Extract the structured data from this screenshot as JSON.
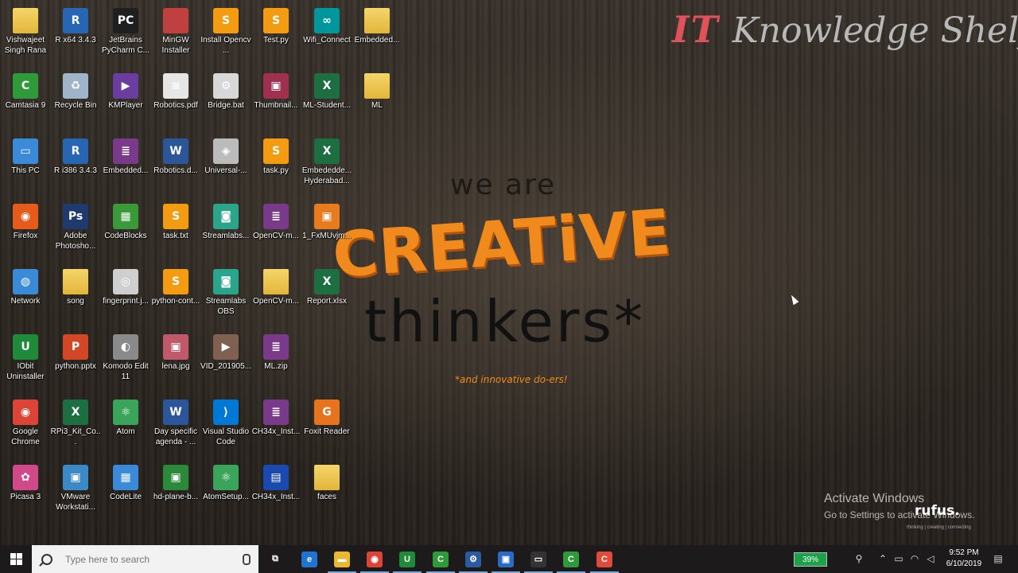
{
  "wallpaper": {
    "brand_it": "IT",
    "brand_name": "Knowledge Shelf",
    "we_are": "we are",
    "creative": "CREATiVE",
    "thinkers": "thinkers*",
    "tagline": "*and innovative do-ers!",
    "activate_title": "Activate Windows",
    "activate_sub": "Go to Settings to activate Windows.",
    "rufus": "rufus.",
    "rufus_sub": "thinking | creating | connecting"
  },
  "icons": [
    {
      "label": "Vishwajeet Singh Rana",
      "icon": "user-folder-icon",
      "color": "#e8c040",
      "glyph": ""
    },
    {
      "label": "R x64 3.4.3",
      "icon": "r-icon",
      "color": "#2766b3",
      "glyph": "R"
    },
    {
      "label": "JetBrains PyCharm C...",
      "icon": "pycharm-icon",
      "color": "#1f1f1f",
      "glyph": "PC"
    },
    {
      "label": "MinGW Installer",
      "icon": "installer-icon",
      "color": "#c04040",
      "glyph": ""
    },
    {
      "label": "Install Opencv ...",
      "icon": "sublime-file-icon",
      "color": "#f39c12",
      "glyph": "S"
    },
    {
      "label": "Test.py",
      "icon": "sublime-file-icon",
      "color": "#f39c12",
      "glyph": "S"
    },
    {
      "label": "Wifi_Connect",
      "icon": "arduino-file-icon",
      "color": "#00979c",
      "glyph": "∞"
    },
    {
      "label": "Embedded...",
      "icon": "folder-icon",
      "color": "#e8c040",
      "glyph": ""
    },
    {
      "label": "Camtasia 9",
      "icon": "camtasia-icon",
      "color": "#2e9a3a",
      "glyph": "C"
    },
    {
      "label": "Recycle Bin",
      "icon": "recycle-bin-icon",
      "color": "#9fb4c8",
      "glyph": "♻"
    },
    {
      "label": "KMPlayer",
      "icon": "kmplayer-icon",
      "color": "#6a3ea0",
      "glyph": "▶"
    },
    {
      "label": "Robotics.pdf",
      "icon": "pdf-icon",
      "color": "#e6e6e6",
      "glyph": "≡"
    },
    {
      "label": "Bridge.bat",
      "icon": "bat-file-icon",
      "color": "#d8d8d8",
      "glyph": "⚙"
    },
    {
      "label": "Thumbnail...",
      "icon": "image-file-icon",
      "color": "#a03050",
      "glyph": "▣"
    },
    {
      "label": "ML-Student...",
      "icon": "excel-icon",
      "color": "#1d6f42",
      "glyph": "X"
    },
    {
      "label": "ML",
      "icon": "folder-icon",
      "color": "#e8c040",
      "glyph": ""
    },
    {
      "label": "This PC",
      "icon": "computer-icon",
      "color": "#3a8ad8",
      "glyph": "▭"
    },
    {
      "label": "R i386 3.4.3",
      "icon": "r-icon",
      "color": "#2766b3",
      "glyph": "R"
    },
    {
      "label": "Embedded...",
      "icon": "winrar-icon",
      "color": "#7a3a8a",
      "glyph": "≣"
    },
    {
      "label": "Robotics.d...",
      "icon": "word-icon",
      "color": "#2b579a",
      "glyph": "W"
    },
    {
      "label": "Universal-...",
      "icon": "usb-installer-icon",
      "color": "#bbbbbb",
      "glyph": "◈"
    },
    {
      "label": "task.py",
      "icon": "sublime-file-icon",
      "color": "#f39c12",
      "glyph": "S"
    },
    {
      "label": "Embededde... Hyderabad...",
      "icon": "excel-icon",
      "color": "#1d6f42",
      "glyph": "X"
    },
    {
      "label": "Firefox",
      "icon": "firefox-icon",
      "color": "#e55b1c",
      "glyph": "◉"
    },
    {
      "label": "Adobe Photosho...",
      "icon": "photoshop-icon",
      "color": "#1e3a6e",
      "glyph": "Ps"
    },
    {
      "label": "CodeBlocks",
      "icon": "codeblocks-icon",
      "color": "#3a9a3a",
      "glyph": "▦"
    },
    {
      "label": "task.txt",
      "icon": "sublime-file-icon",
      "color": "#f39c12",
      "glyph": "S"
    },
    {
      "label": "Streamlabs...",
      "icon": "streamlabs-icon",
      "color": "#2aa58c",
      "glyph": "◙"
    },
    {
      "label": "OpenCV-m...",
      "icon": "winrar-icon",
      "color": "#7a3a8a",
      "glyph": "≣"
    },
    {
      "label": "1_FxMUvjm...",
      "icon": "image-file-icon",
      "color": "#e87b1e",
      "glyph": "▣"
    },
    {
      "label": "Network",
      "icon": "network-icon",
      "color": "#3a8ad8",
      "glyph": "◍"
    },
    {
      "label": "song",
      "icon": "music-folder-icon",
      "color": "#d8b040",
      "glyph": ""
    },
    {
      "label": "fingerprint.j...",
      "icon": "image-file-icon",
      "color": "#cfcfcf",
      "glyph": "◎"
    },
    {
      "label": "python-cont...",
      "icon": "sublime-file-icon",
      "color": "#f39c12",
      "glyph": "S"
    },
    {
      "label": "Streamlabs OBS",
      "icon": "streamlabs-icon",
      "color": "#2aa58c",
      "glyph": "◙"
    },
    {
      "label": "OpenCV-m...",
      "icon": "folder-icon",
      "color": "#e8c040",
      "glyph": ""
    },
    {
      "label": "Report.xlsx",
      "icon": "excel-icon",
      "color": "#1d6f42",
      "glyph": "X"
    },
    {
      "label": "IObit Uninstaller",
      "icon": "iobit-icon",
      "color": "#1f8a3a",
      "glyph": "U"
    },
    {
      "label": "python.pptx",
      "icon": "powerpoint-icon",
      "color": "#d24726",
      "glyph": "P"
    },
    {
      "label": "Komodo Edit 11",
      "icon": "komodo-icon",
      "color": "#8a8a8a",
      "glyph": "◐"
    },
    {
      "label": "lena.jpg",
      "icon": "image-file-icon",
      "color": "#c05a6a",
      "glyph": "▣"
    },
    {
      "label": "VID_201905...",
      "icon": "video-file-icon",
      "color": "#806050",
      "glyph": "▶"
    },
    {
      "label": "ML.zip",
      "icon": "winrar-icon",
      "color": "#7a3a8a",
      "glyph": "≣"
    },
    {
      "label": "Google Chrome",
      "icon": "chrome-icon",
      "color": "#db4437",
      "glyph": "◉"
    },
    {
      "label": "RPi3_Kit_Co...",
      "icon": "excel-icon",
      "color": "#1d6f42",
      "glyph": "X"
    },
    {
      "label": "Atom",
      "icon": "atom-icon",
      "color": "#3aa55a",
      "glyph": "⚛"
    },
    {
      "label": "Day specific agenda - ...",
      "icon": "word-icon",
      "color": "#2b579a",
      "glyph": "W"
    },
    {
      "label": "Visual Studio Code",
      "icon": "vscode-icon",
      "color": "#0078d4",
      "glyph": "⟩"
    },
    {
      "label": "CH34x_Inst...",
      "icon": "winrar-icon",
      "color": "#7a3a8a",
      "glyph": "≣"
    },
    {
      "label": "Foxit Reader",
      "icon": "foxit-icon",
      "color": "#e8731e",
      "glyph": "G"
    },
    {
      "label": "Picasa 3",
      "icon": "picasa-icon",
      "color": "#d04a8a",
      "glyph": "✿"
    },
    {
      "label": "VMware Workstati...",
      "icon": "vmware-icon",
      "color": "#3a8ac8",
      "glyph": "▣"
    },
    {
      "label": "CodeLite",
      "icon": "codelite-icon",
      "color": "#3a8ad8",
      "glyph": "▦"
    },
    {
      "label": "hd-plane-b...",
      "icon": "image-file-icon",
      "color": "#2a8a3a",
      "glyph": "▣"
    },
    {
      "label": "AtomSetup...",
      "icon": "atom-icon",
      "color": "#3aa55a",
      "glyph": "⚛"
    },
    {
      "label": "CH34x_Inst...",
      "icon": "installer-icon",
      "color": "#1a4ab0",
      "glyph": "▤"
    },
    {
      "label": "faces",
      "icon": "folder-icon",
      "color": "#e8c040",
      "glyph": ""
    }
  ],
  "taskbar": {
    "search_placeholder": "Type here to search",
    "apps": [
      {
        "name": "task-view-icon",
        "glyph": "⧉",
        "color": "transparent"
      },
      {
        "name": "edge-icon",
        "glyph": "e",
        "color": "#1e74d0"
      },
      {
        "name": "file-explorer-icon",
        "glyph": "▬",
        "color": "#e8b830"
      },
      {
        "name": "chrome-icon",
        "glyph": "◉",
        "color": "#db4437"
      },
      {
        "name": "iobit-icon",
        "glyph": "U",
        "color": "#1f8a3a"
      },
      {
        "name": "camtasia-icon",
        "glyph": "C",
        "color": "#2e9a3a"
      },
      {
        "name": "network-app-icon",
        "glyph": "⚙",
        "color": "#2a5aa0"
      },
      {
        "name": "store-icon",
        "glyph": "▣",
        "color": "#2a6ac8"
      },
      {
        "name": "terminal-icon",
        "glyph": "▭",
        "color": "#333"
      },
      {
        "name": "camtasia-recorder-icon",
        "glyph": "C",
        "color": "#2e9a3a"
      },
      {
        "name": "camtasia-rec-icon",
        "glyph": "C",
        "color": "#e04a3a"
      }
    ],
    "battery": "39%",
    "time": "9:52 PM",
    "date": "6/10/2019"
  }
}
